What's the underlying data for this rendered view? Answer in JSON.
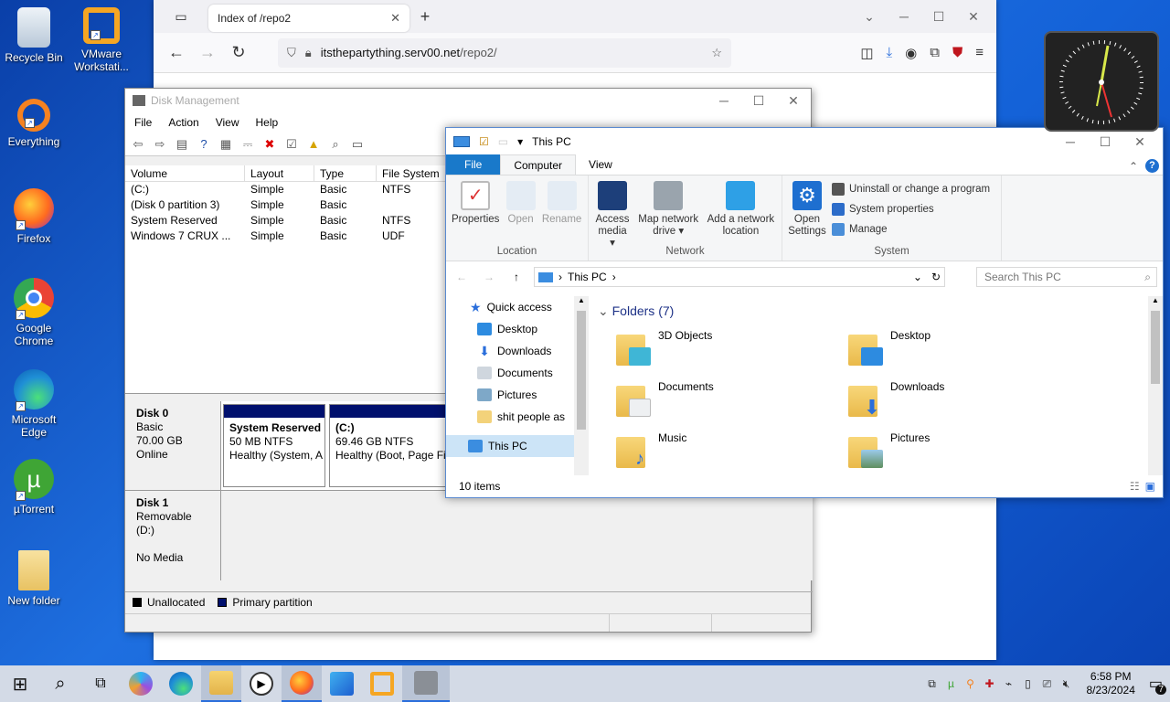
{
  "desktop": {
    "icons": [
      {
        "label": "Recycle Bin",
        "color": "#dfe8f0"
      },
      {
        "label": "VMware Workstati...",
        "color": "#f5a623"
      },
      {
        "label": "Everything",
        "color": "#f58220"
      },
      {
        "label": "Firefox",
        "color": "#ff6a1f"
      },
      {
        "label": "Google Chrome",
        "color": "#34a853"
      },
      {
        "label": "Microsoft Edge",
        "color": "#1f8fd6"
      },
      {
        "label": "µTorrent",
        "color": "#3fa535"
      },
      {
        "label": "New folder",
        "color": "#f3cf6e"
      }
    ]
  },
  "browser": {
    "tab_title": "Index of /repo2",
    "url_host": "itsthepartything.serv00.net",
    "url_path": "/repo2/"
  },
  "diskmgmt": {
    "title": "Disk Management",
    "menu": [
      "File",
      "Action",
      "View",
      "Help"
    ],
    "columns": [
      "Volume",
      "Layout",
      "Type",
      "File System"
    ],
    "rows": [
      [
        "(C:)",
        "Simple",
        "Basic",
        "NTFS"
      ],
      [
        "(Disk 0 partition 3)",
        "Simple",
        "Basic",
        ""
      ],
      [
        "System Reserved",
        "Simple",
        "Basic",
        "NTFS"
      ],
      [
        "Windows 7 CRUX ...",
        "Simple",
        "Basic",
        "UDF"
      ]
    ],
    "disk0": {
      "name": "Disk 0",
      "type": "Basic",
      "size": "70.00 GB",
      "status": "Online",
      "p1": {
        "name": "System Reserved",
        "size": "50 MB NTFS",
        "status": "Healthy (System, A"
      },
      "p2": {
        "name": "(C:)",
        "size": "69.46 GB NTFS",
        "status": "Healthy (Boot, Page File"
      }
    },
    "disk1": {
      "name": "Disk 1",
      "type": "Removable (D:)",
      "status": "No Media"
    },
    "legend": {
      "unallocated": "Unallocated",
      "primary": "Primary partition"
    }
  },
  "explorer": {
    "title": "This PC",
    "tabs": {
      "file": "File",
      "computer": "Computer",
      "view": "View"
    },
    "ribbon": {
      "properties": "Properties",
      "open": "Open",
      "rename": "Rename",
      "location": "Location",
      "access_media": "Access media ▾",
      "map_drive": "Map network drive ▾",
      "add_location": "Add a network location",
      "network": "Network",
      "open_settings": "Open Settings",
      "uninstall": "Uninstall or change a program",
      "sysprops": "System properties",
      "manage": "Manage",
      "system": "System"
    },
    "address": "This PC",
    "search_placeholder": "Search This PC",
    "nav": [
      "Quick access",
      "Desktop",
      "Downloads",
      "Documents",
      "Pictures",
      "shit people as",
      "This PC"
    ],
    "folders_header": "Folders (7)",
    "folders": [
      "3D Objects",
      "Desktop",
      "Documents",
      "Downloads",
      "Music",
      "Pictures"
    ],
    "status": "10 items"
  },
  "taskbar": {
    "time": "6:58 PM",
    "date": "8/23/2024",
    "notifications": "7"
  }
}
